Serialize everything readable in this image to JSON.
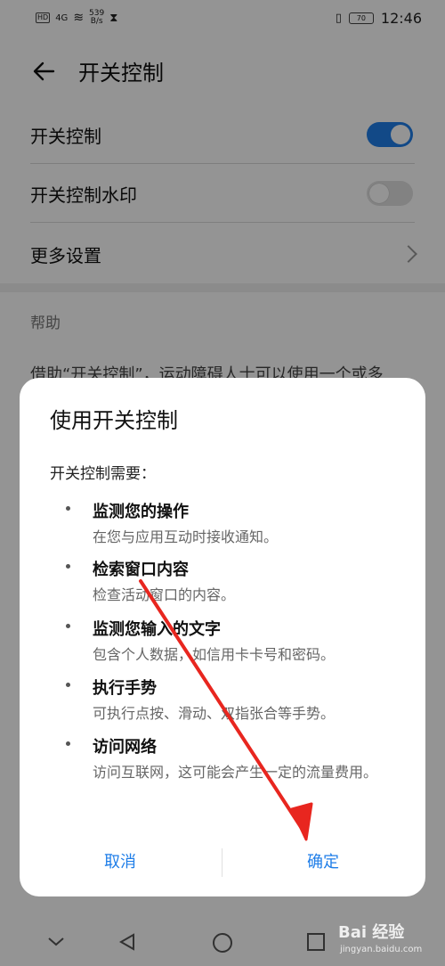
{
  "status_bar": {
    "network_tag": "HD",
    "signal": "4G",
    "speed_top": "539",
    "speed_bottom": "B/s",
    "battery": "70",
    "time": "12:46"
  },
  "header": {
    "title": "开关控制"
  },
  "settings": {
    "switch_control_label": "开关控制",
    "switch_control_on": true,
    "watermark_label": "开关控制水印",
    "watermark_on": false,
    "more_label": "更多设置"
  },
  "help": {
    "label": "帮助",
    "text": "借助“开关控制”，运动障碍人士可以使用一个或多"
  },
  "dialog": {
    "title": "使用开关控制",
    "subtitle": "开关控制需要：",
    "permissions": [
      {
        "title": "监测您的操作",
        "desc": "在您与应用互动时接收通知。"
      },
      {
        "title": "检索窗口内容",
        "desc": "检查活动窗口的内容。"
      },
      {
        "title": "监测您输入的文字",
        "desc": "包含个人数据，如信用卡卡号和密码。"
      },
      {
        "title": "执行手势",
        "desc": "可执行点按、滑动、双指张合等手势。"
      },
      {
        "title": "访问网络",
        "desc": "访问互联网，这可能会产生一定的流量费用。"
      }
    ],
    "cancel_label": "取消",
    "confirm_label": "确定"
  },
  "watermark": {
    "brand": "Bai 经验",
    "site": "jingyan.baidu.com"
  },
  "colors": {
    "accent": "#1f7ee8",
    "annotation": "#e8261f"
  }
}
